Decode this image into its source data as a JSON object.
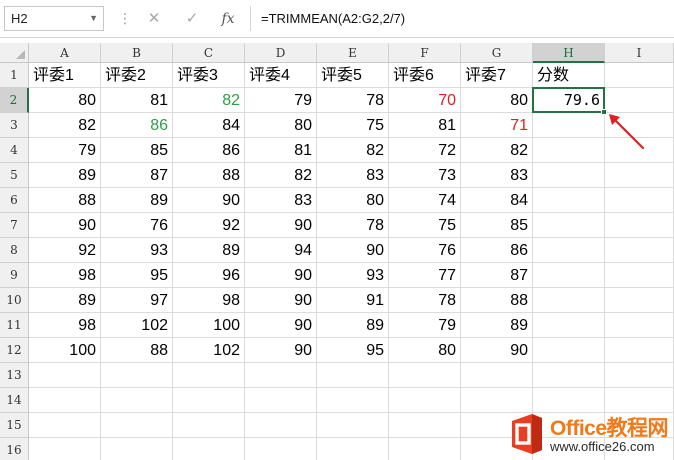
{
  "formula_bar": {
    "name_box": "H2",
    "cancel_glyph": "✕",
    "enter_glyph": "✓",
    "fx_label": "fx",
    "formula": "=TRIMMEAN(A2:G2,2/7)"
  },
  "sheet": {
    "columns": [
      "A",
      "B",
      "C",
      "D",
      "E",
      "F",
      "G",
      "H",
      "I"
    ],
    "rows": [
      "1",
      "2",
      "3",
      "4",
      "5",
      "6",
      "7",
      "8",
      "9",
      "10",
      "11",
      "12",
      "13",
      "14",
      "15",
      "16"
    ],
    "selected_column": "H",
    "selected_row": "2",
    "active_cell": "H2",
    "header_row": [
      "评委1",
      "评委2",
      "评委3",
      "评委4",
      "评委5",
      "评委6",
      "评委7",
      "分数"
    ],
    "data_rows": [
      [
        "80",
        "81",
        "82",
        "79",
        "78",
        "70",
        "80",
        "79.6"
      ],
      [
        "82",
        "86",
        "84",
        "80",
        "75",
        "81",
        "71",
        ""
      ],
      [
        "79",
        "85",
        "86",
        "81",
        "82",
        "72",
        "82",
        ""
      ],
      [
        "89",
        "87",
        "88",
        "82",
        "83",
        "73",
        "83",
        ""
      ],
      [
        "88",
        "89",
        "90",
        "83",
        "80",
        "74",
        "84",
        ""
      ],
      [
        "90",
        "76",
        "92",
        "90",
        "78",
        "75",
        "85",
        ""
      ],
      [
        "92",
        "93",
        "89",
        "94",
        "90",
        "76",
        "86",
        ""
      ],
      [
        "98",
        "95",
        "96",
        "90",
        "93",
        "77",
        "87",
        ""
      ],
      [
        "89",
        "97",
        "98",
        "90",
        "91",
        "78",
        "88",
        ""
      ],
      [
        "98",
        "102",
        "100",
        "90",
        "89",
        "79",
        "89",
        ""
      ],
      [
        "100",
        "88",
        "102",
        "90",
        "95",
        "80",
        "90",
        ""
      ]
    ],
    "highlighted_cells": [
      {
        "cell": "C2",
        "color": "#2e9f45"
      },
      {
        "cell": "F2",
        "color": "#e02020"
      },
      {
        "cell": "B3",
        "color": "#2e9f45"
      },
      {
        "cell": "G3",
        "color": "#e02020"
      }
    ]
  },
  "annotation": {
    "arrow_color": "#e02020"
  },
  "watermark": {
    "brand": "Office教程网",
    "url": "www.office26.com",
    "icon": "office-logo-icon",
    "brand_color": "#f07a1a"
  }
}
